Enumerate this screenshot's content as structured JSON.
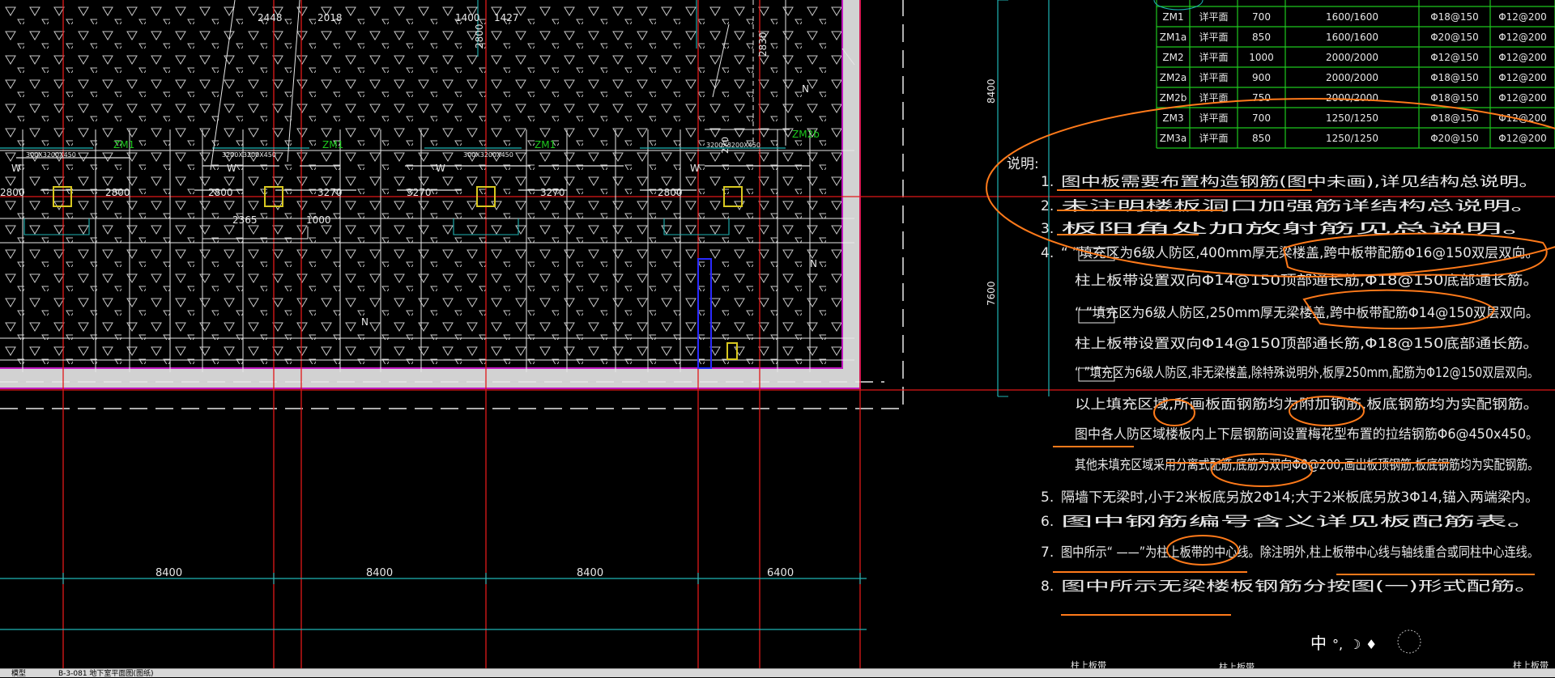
{
  "notes": {
    "title": "说明:",
    "items": [
      {
        "num": "1.",
        "text": "图中板需要布置构造钢筋(图中未画),详见结构总说明。"
      },
      {
        "num": "2.",
        "text": "未注明楼板洞口加强筋详结构总说明。"
      },
      {
        "num": "3.",
        "text": "板阳角处加放射筋见总说明。"
      },
      {
        "num": "4.",
        "text": "“    ”填充区为6级人防区,400mm厚无梁楼盖,跨中板带配筋Φ16@150双层双向。"
      },
      {
        "num": "",
        "text": "柱上板带设置双向Φ14@150顶部通长筋,Φ18@150底部通长筋。"
      },
      {
        "num": "",
        "text": "“    ”填充区为6级人防区,250mm厚无梁楼盖,跨中板带配筋Φ14@150双层双向。"
      },
      {
        "num": "",
        "text": "柱上板带设置双向Φ14@150顶部通长筋,Φ18@150底部通长筋。"
      },
      {
        "num": "",
        "text": "“    ”填充区为6级人防区,非无梁楼盖,除特殊说明外,板厚250mm,配筋为Φ12@150双层双向。"
      },
      {
        "num": "",
        "text": "以上填充区域,所画板面钢筋均为附加钢筋,板底钢筋均为实配钢筋。"
      },
      {
        "num": "",
        "text": "图中各人防区域楼板内上下层钢筋间设置梅花型布置的拉结钢筋Φ6@450x450。"
      },
      {
        "num": "",
        "text": "其他未填充区域采用分离式配筋,底筋为双向Φ8@200,画出板顶钢筋,板底钢筋均为实配钢筋。"
      },
      {
        "num": "5.",
        "text": "隔墙下无梁时,小于2米板底另放2Φ14;大于2米板底另放3Φ14,锚入两端梁内。"
      },
      {
        "num": "6.",
        "text": "图中钢筋编号含义详见板配筋表。"
      },
      {
        "num": "7.",
        "text": "图中所示“    ——”为柱上板带的中心线。除注明外,柱上板带中心线与轴线重合或同柱中心连线。"
      },
      {
        "num": "8.",
        "text": "图中所示无梁楼板钢筋分按图(一)形式配筋。"
      }
    ]
  },
  "column_table": {
    "rows": [
      [
        "ZM1",
        "详平面",
        "700",
        "1600/1600",
        "Φ18@150",
        "Φ12@200"
      ],
      [
        "ZM1a",
        "详平面",
        "850",
        "1600/1600",
        "Φ20@150",
        "Φ12@200"
      ],
      [
        "ZM2",
        "详平面",
        "1000",
        "2000/2000",
        "Φ12@150",
        "Φ12@200"
      ],
      [
        "ZM2a",
        "详平面",
        "900",
        "2000/2000",
        "Φ18@150",
        "Φ12@200"
      ],
      [
        "ZM2b",
        "详平面",
        "750",
        "2000/2000",
        "Φ18@150",
        "Φ12@200"
      ],
      [
        "ZM3",
        "详平面",
        "700",
        "1250/1250",
        "Φ18@150",
        "Φ12@200"
      ],
      [
        "ZM3a",
        "详平面",
        "850",
        "1250/1250",
        "Φ20@150",
        "Φ12@200"
      ]
    ]
  },
  "dimensions": {
    "bottom": [
      "8400",
      "8400",
      "8400",
      "6400"
    ],
    "top": [
      "2448",
      "2018",
      "1400",
      "1427"
    ],
    "vertical_right": [
      "8400",
      "7600"
    ],
    "span": [
      "2800",
      "2800",
      "2800",
      "3270",
      "3270",
      "3270",
      "2800"
    ],
    "misc": [
      "2365",
      "1000",
      "2800",
      "2830",
      "270"
    ]
  },
  "labels": {
    "zm": [
      "ZM1",
      "ZM1",
      "ZM1",
      "ZM2b"
    ],
    "w": [
      "W",
      "W",
      "W",
      "W"
    ],
    "n": [
      "N",
      "N",
      "N"
    ],
    "beam": [
      "300X3200X450",
      "3200X3200X450",
      "300X3200X450",
      "3200X3200X450"
    ]
  },
  "ime": {
    "text": "中",
    "icons": [
      "punct-icon",
      "moon-icon",
      "shirt-icon"
    ]
  },
  "status": {
    "left": "模型",
    "file": "B-3-081 地下室平面图(图纸)",
    "bottom_right": "柱上板带",
    "bottom_mid": "柱上板带",
    "bottom_left": "柱上板带"
  },
  "colors": {
    "red": "#e01818",
    "white": "#e8e8e8",
    "cyan": "#1fb5b5",
    "green": "#1ec81e",
    "yellow": "#d8c820",
    "orange": "#ff7a1a",
    "magenta": "#c018c0",
    "grey": "#d2d2d2"
  }
}
